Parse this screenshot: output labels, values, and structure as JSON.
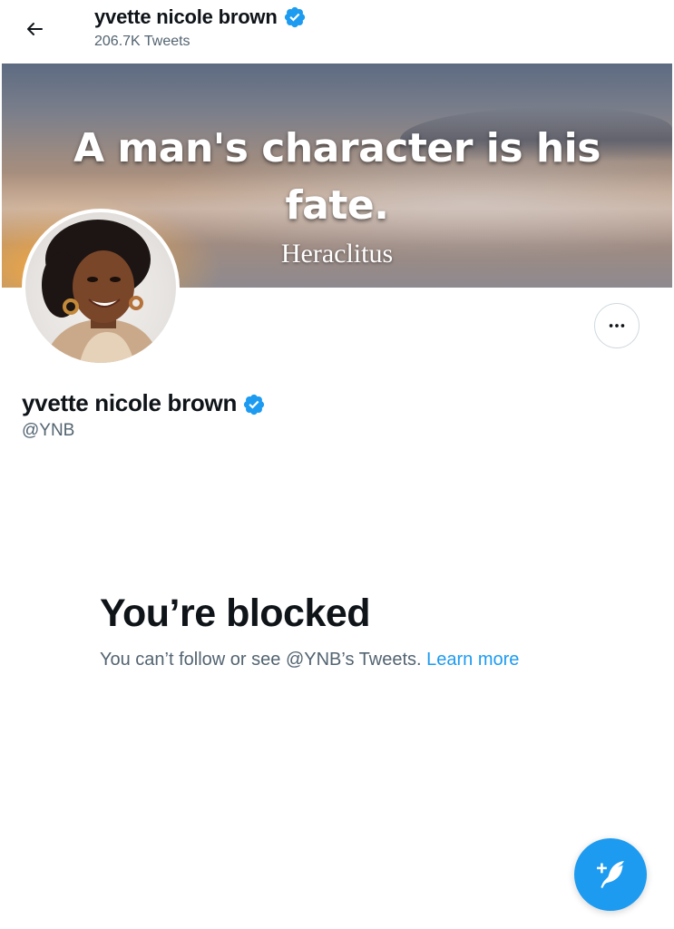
{
  "header": {
    "display_name": "yvette nicole brown",
    "tweet_count": "206.7K Tweets",
    "back_icon": "arrow-left-icon",
    "verified_icon": "verified-badge-icon"
  },
  "banner": {
    "quote_line1": "A man's character is his",
    "quote_line2": "fate.",
    "attribution": "Heraclitus"
  },
  "profile": {
    "display_name": "yvette nicole brown",
    "handle": "@YNB",
    "more_icon": "more-options-icon"
  },
  "blocked": {
    "title": "You’re blocked",
    "message": "You can’t follow or see @YNB’s Tweets. ",
    "link": "Learn more"
  },
  "fab": {
    "icon": "compose-tweet-icon"
  },
  "colors": {
    "accent": "#1d9bf0",
    "text_primary": "#0f1419",
    "text_secondary": "#536471",
    "border": "#cfd9de"
  }
}
